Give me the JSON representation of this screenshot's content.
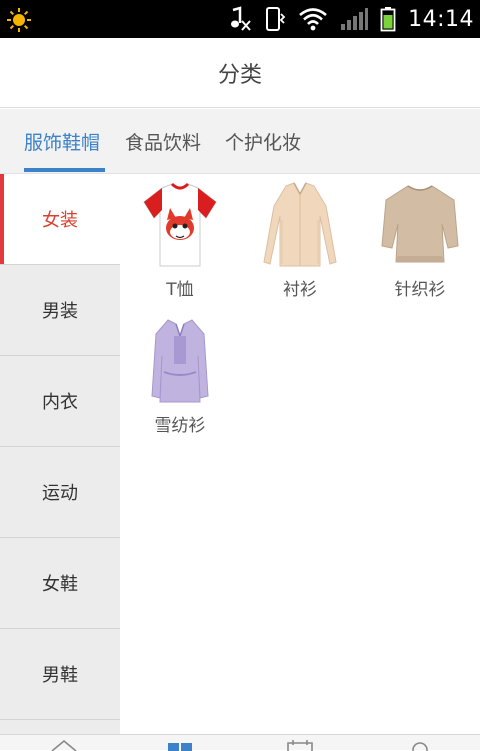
{
  "status_bar": {
    "time": "14:14",
    "icons": [
      "sun-icon",
      "music-muted-icon",
      "vibrate-icon",
      "wifi-icon",
      "signal-icon",
      "battery-icon"
    ]
  },
  "header": {
    "title": "分类"
  },
  "tabs": [
    {
      "label": "服饰鞋帽",
      "active": true
    },
    {
      "label": "食品饮料",
      "active": false
    },
    {
      "label": "个护化妆",
      "active": false
    }
  ],
  "sidebar": {
    "items": [
      {
        "label": "女装",
        "active": true
      },
      {
        "label": "男装",
        "active": false
      },
      {
        "label": "内衣",
        "active": false
      },
      {
        "label": "运动",
        "active": false
      },
      {
        "label": "女鞋",
        "active": false
      },
      {
        "label": "男鞋",
        "active": false
      }
    ]
  },
  "products": [
    {
      "label": "T恤",
      "icon": "tshirt-icon"
    },
    {
      "label": "衬衫",
      "icon": "shirt-icon"
    },
    {
      "label": "针织衫",
      "icon": "knit-sweater-icon"
    },
    {
      "label": "雪纺衫",
      "icon": "chiffon-blouse-icon"
    }
  ],
  "bottom_nav": {
    "icons": [
      "home-icon",
      "category-icon",
      "calendar-icon",
      "profile-icon"
    ]
  },
  "colors": {
    "accent": "#3b82c8",
    "active_category": "#d9412f",
    "marker": "#e23a3a"
  }
}
